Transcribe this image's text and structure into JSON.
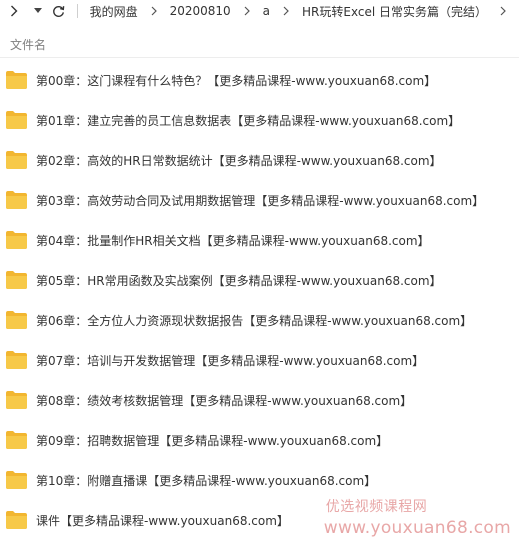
{
  "breadcrumb": {
    "items": [
      "我的网盘",
      "20200810",
      "a",
      "HR玩转Excel 日常实务篇（完结）"
    ]
  },
  "list_header": {
    "name_column": "文件名"
  },
  "files": [
    {
      "name": "第00章：这门课程有什么特色？【更多精品课程-www.youxuan68.com】",
      "type": "folder"
    },
    {
      "name": "第01章：建立完善的员工信息数据表【更多精品课程-www.youxuan68.com】",
      "type": "folder"
    },
    {
      "name": "第02章：高效的HR日常数据统计【更多精品课程-www.youxuan68.com】",
      "type": "folder"
    },
    {
      "name": "第03章：高效劳动合同及试用期数据管理【更多精品课程-www.youxuan68.com】",
      "type": "folder"
    },
    {
      "name": "第04章：批量制作HR相关文档【更多精品课程-www.youxuan68.com】",
      "type": "folder"
    },
    {
      "name": "第05章：HR常用函数及实战案例【更多精品课程-www.youxuan68.com】",
      "type": "folder"
    },
    {
      "name": "第06章：全方位人力资源现状数据报告【更多精品课程-www.youxuan68.com】",
      "type": "folder"
    },
    {
      "name": "第07章：培训与开发数据管理【更多精品课程-www.youxuan68.com】",
      "type": "folder"
    },
    {
      "name": "第08章：绩效考核数据管理【更多精品课程-www.youxuan68.com】",
      "type": "folder"
    },
    {
      "name": "第09章：招聘数据管理【更多精品课程-www.youxuan68.com】",
      "type": "folder"
    },
    {
      "name": "第10章：附赠直播课【更多精品课程-www.youxuan68.com】",
      "type": "folder"
    },
    {
      "name": "课件【更多精品课程-www.youxuan68.com】",
      "type": "folder"
    }
  ],
  "watermark": {
    "line1": "优选视频课程网",
    "line2": "www.youxuan68.com"
  },
  "colors": {
    "folder": "#f7c948",
    "folder_tab": "#f2b630",
    "watermark": "#e8a7a7",
    "header_text": "#808080"
  },
  "icons": {
    "forward": "chevron-right-icon",
    "dropdown": "caret-down-icon",
    "refresh": "refresh-icon",
    "folder": "folder-icon"
  }
}
